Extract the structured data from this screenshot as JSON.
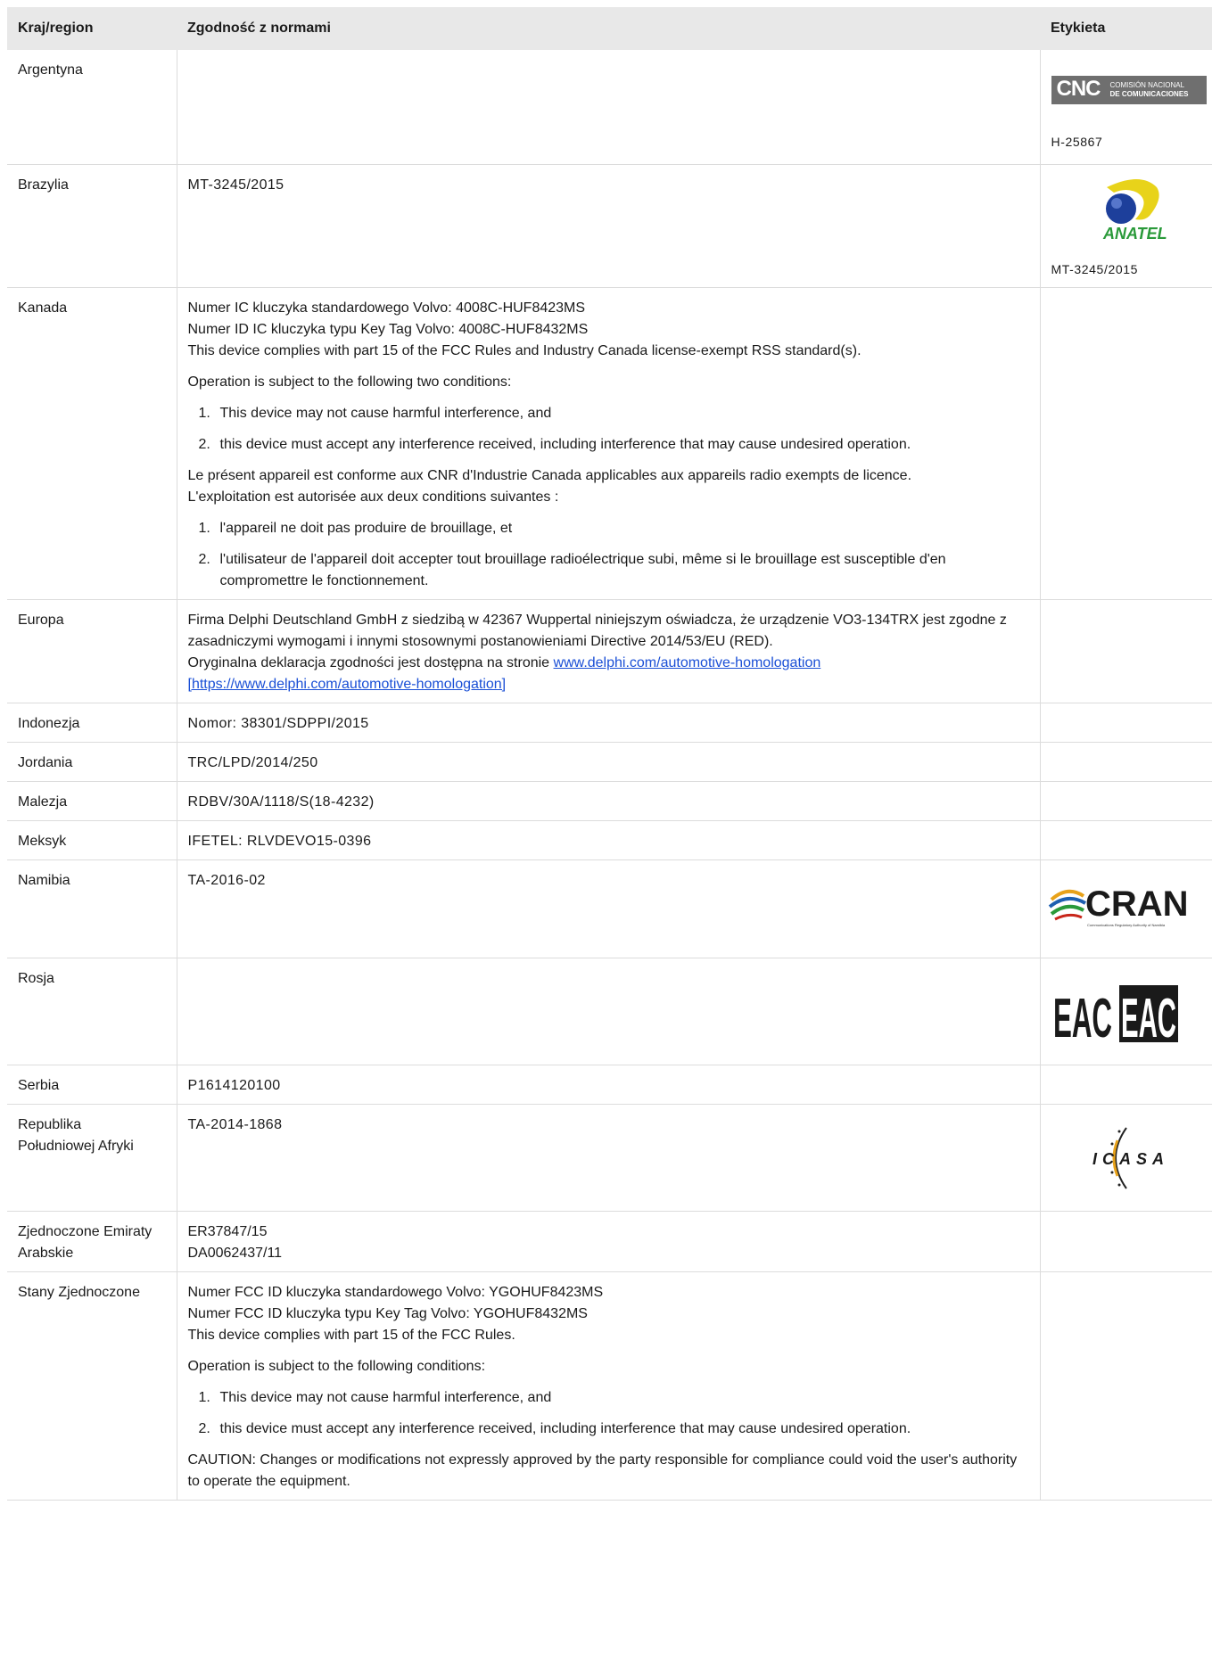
{
  "headers": {
    "country": "Kraj/region",
    "compliance": "Zgodność z normami",
    "label": "Etykieta"
  },
  "rows": {
    "argentina": {
      "country": "Argentyna",
      "label_text": "H-25867",
      "logo_big": "CNC",
      "logo_small_1": "COMISIÓN NACIONAL",
      "logo_small_2": "DE COMUNICACIONES"
    },
    "brazil": {
      "country": "Brazylia",
      "compliance": "MT-3245/2015",
      "label_text": "MT-3245/2015",
      "logo_text": "ANATEL"
    },
    "canada": {
      "country": "Kanada",
      "line1": "Numer IC kluczyka standardowego Volvo: 4008C-HUF8423MS",
      "line2": "Numer ID IC kluczyka typu Key Tag Volvo: 4008C-HUF8432MS",
      "line3": "This device complies with part 15 of the FCC Rules and Industry Canada license-exempt RSS standard(s).",
      "para2": "Operation is subject to the following two conditions:",
      "item1": "This device may not cause harmful interference, and",
      "item2": "this device must accept any interference received, including interference that may cause undesired operation.",
      "fr1": "Le présent appareil est conforme aux CNR d'Industrie Canada applicables aux appareils radio exempts de licence.",
      "fr2": "L'exploitation est autorisée aux deux conditions suivantes :",
      "fritem1": "l'appareil ne doit pas produire de brouillage, et",
      "fritem2": "l'utilisateur de l'appareil doit accepter tout brouillage radioélectrique subi, même si le brouillage est susceptible d'en compromettre le fonctionnement."
    },
    "europe": {
      "country": "Europa",
      "text1": "Firma Delphi Deutschland GmbH z siedzibą w 42367 Wuppertal niniejszym oświadcza, że urządzenie VO3-134TRX jest zgodne z zasadniczymi wymogami i innymi stosownymi postanowieniami Directive 2014/53/EU (RED).",
      "text2": "Oryginalna deklaracja zgodności jest dostępna na stronie ",
      "link": "www.delphi.com/automotive-homologation [https://www.delphi.com/automotive-homologation]"
    },
    "indonesia": {
      "country": "Indonezja",
      "compliance": "Nomor: 38301/SDPPI/2015"
    },
    "jordan": {
      "country": "Jordania",
      "compliance": "TRC/LPD/2014/250"
    },
    "malaysia": {
      "country": "Malezja",
      "compliance": "RDBV/30A/1118/S(18-4232)"
    },
    "mexico": {
      "country": "Meksyk",
      "compliance": "IFETEL: RLVDEVO15-0396"
    },
    "namibia": {
      "country": "Namibia",
      "compliance": "TA-2016-02",
      "logo_text": "CRAN",
      "logo_sub": "Communications Regulatory Authority of Namibia"
    },
    "russia": {
      "country": "Rosja",
      "logo_text_1": "EAC",
      "logo_text_2": "EAC"
    },
    "serbia": {
      "country": "Serbia",
      "compliance": "P1614120100"
    },
    "south_africa": {
      "country_1": "Republika",
      "country_2": "Południowej Afryki",
      "compliance": "TA-2014-1868",
      "logo_text": "ICASA"
    },
    "uae": {
      "country_1": "Zjednoczone Emiraty",
      "country_2": "Arabskie",
      "line1": "ER37847/15",
      "line2": "DA0062437/11"
    },
    "usa": {
      "country": "Stany Zjednoczone",
      "line1": "Numer FCC ID kluczyka standardowego Volvo: YGOHUF8423MS",
      "line2": "Numer FCC ID kluczyka typu Key Tag Volvo: YGOHUF8432MS",
      "line3": "This device complies with part 15 of the FCC Rules.",
      "para2": "Operation is subject to the following conditions:",
      "item1": "This device may not cause harmful interference, and",
      "item2": "this device must accept any interference received, including interference that may cause undesired operation.",
      "caution": "CAUTION: Changes or modifications not expressly approved by the party responsible for compliance could void the user's authority to operate the equipment."
    }
  },
  "list_numbers": {
    "n1": "1.",
    "n2": "2."
  },
  "colors": {
    "header_bg": "#e8e8e8",
    "border": "#dcdcdc",
    "link": "#1a4fd6",
    "anatel_yellow": "#e8d31a",
    "anatel_blue": "#1d3f9b",
    "cran_text": "#1a1a1a"
  }
}
